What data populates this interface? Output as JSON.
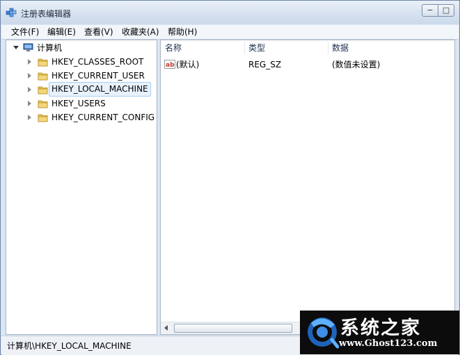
{
  "window": {
    "title": "注册表编辑器",
    "app_icon": "registry-editor-icon",
    "controls": {
      "minimize": "−",
      "maximize": "□"
    }
  },
  "menu": {
    "items": [
      "文件(F)",
      "编辑(E)",
      "查看(V)",
      "收藏夹(A)",
      "帮助(H)"
    ]
  },
  "tree": {
    "root": {
      "label": "计算机",
      "icon": "computer-icon",
      "expanded": true
    },
    "children": [
      {
        "label": "HKEY_CLASSES_ROOT",
        "icon": "folder-icon"
      },
      {
        "label": "HKEY_CURRENT_USER",
        "icon": "folder-icon"
      },
      {
        "label": "HKEY_LOCAL_MACHINE",
        "icon": "folder-icon",
        "selected": true
      },
      {
        "label": "HKEY_USERS",
        "icon": "folder-icon"
      },
      {
        "label": "HKEY_CURRENT_CONFIG",
        "icon": "folder-icon"
      }
    ]
  },
  "list": {
    "columns": [
      "名称",
      "类型",
      "数据"
    ],
    "rows": [
      {
        "name": "(默认)",
        "type": "REG_SZ",
        "data": "(数值未设置)",
        "icon": "string-value-icon"
      }
    ]
  },
  "status": {
    "path": "计算机\\HKEY_LOCAL_MACHINE"
  },
  "watermark": {
    "title": "系统之家",
    "url": "www.Ghost123.com"
  },
  "colors": {
    "selection_bg": "#e8f2fc",
    "selection_border": "#a8cdef",
    "folder": "#e8c25a",
    "title_bg": "#d5e1ef"
  }
}
